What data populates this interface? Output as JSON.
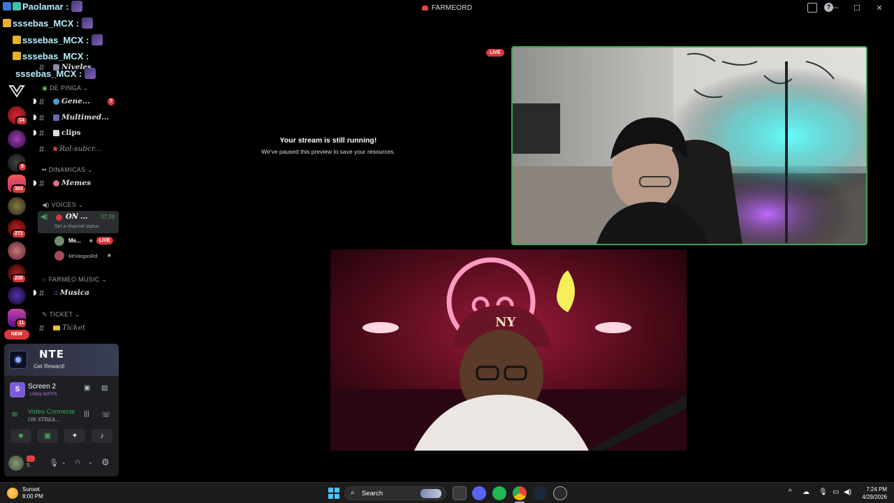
{
  "window": {
    "title": "FARMEORD"
  },
  "chat_overlay": [
    {
      "user": "Paolamar :"
    },
    {
      "user": "sssebas_MCX :"
    },
    {
      "user": "sssebas_MCX :"
    },
    {
      "user": "sssebas_MCX :"
    },
    {
      "user": "sssebas_MCX :"
    }
  ],
  "server_badges": {
    "b1": "14",
    "b2": "5",
    "b3": "303",
    "b4": "272",
    "b5": "238",
    "b6": "11",
    "new_label": "NEW"
  },
  "channels": {
    "partial_top": "Niveles",
    "cat_de_pinga": "DE PINGA",
    "general": "Gene...",
    "general_mentions": "7",
    "multimedia": "Multimed...",
    "clips": "clips",
    "rol": "Rol-subcr...",
    "cat_dinamicas": "DINAMICAS",
    "memes": "Memes",
    "cat_voices": "VOICES",
    "voice_channel": "ON ...",
    "voice_timer": "37:39",
    "voice_status": "Set a channel status",
    "voice_user1": "Me...",
    "voice_user1_live": "LIVE",
    "voice_user2": "MrVargasRd",
    "cat_music": "FARMEO MUSIC",
    "musica": "Musica",
    "cat_ticket": "TICKET",
    "ticket": "Ticket"
  },
  "panel": {
    "promo_brand": "NTE",
    "promo_cta": "Get Reward!",
    "screen_title": "Screen 2",
    "screen_quality": "1080p 60FPS",
    "voice_title": "Video Connecte",
    "voice_sub": "ON STREA...",
    "user_short": "S."
  },
  "stage": {
    "paused_title": "Your stream is still running!",
    "paused_sub": "We've paused this preview to save your resources.",
    "live_tag": "LIVE"
  },
  "taskbar": {
    "weather_label": "Sunset",
    "weather_time": "8:00 PM",
    "search_label": "Search",
    "clock_time": "7:24 PM",
    "clock_date": "4/29/2026"
  },
  "colors": {
    "accent_green": "#43a25a",
    "live_red": "#da373c",
    "discord_bg": "#000000"
  }
}
